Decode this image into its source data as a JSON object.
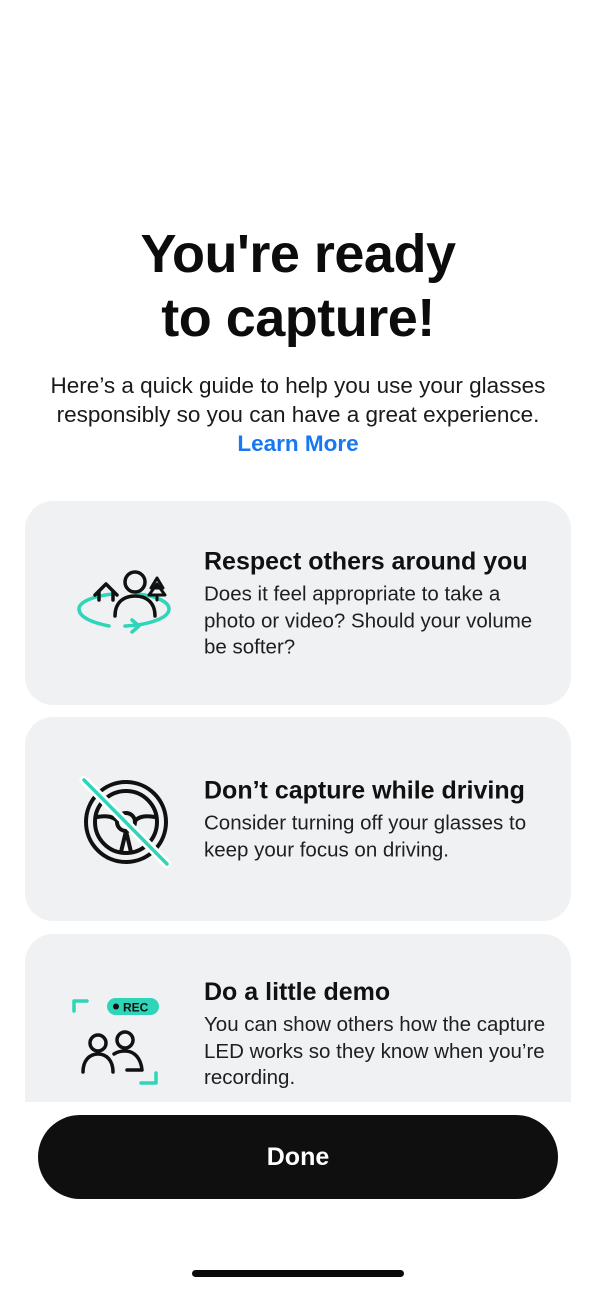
{
  "header": {
    "title_line1": "You're ready",
    "title_line2": "to capture!",
    "subtitle": "Here’s a quick guide to help you use your glasses responsibly so you can have a great experience.",
    "learn_more": "Learn More"
  },
  "cards": [
    {
      "icon": "people-surroundings-icon",
      "title": "Respect others around you",
      "body": "Does it feel appropriate to take a photo or video? Should your volume be softer?"
    },
    {
      "icon": "no-driving-icon",
      "title": "Don’t capture while driving",
      "body": "Consider turning off your glasses to keep your focus on driving."
    },
    {
      "icon": "rec-demo-icon",
      "rec_label": "REC",
      "title": "Do a little demo",
      "body": "You can show others how the capture LED works so they know when you’re recording."
    }
  ],
  "footer": {
    "done_label": "Done"
  },
  "colors": {
    "accent_teal": "#2fd5b8",
    "link_blue": "#1877f2",
    "card_bg": "#f0f1f3",
    "button_bg": "#0f0f0f"
  }
}
